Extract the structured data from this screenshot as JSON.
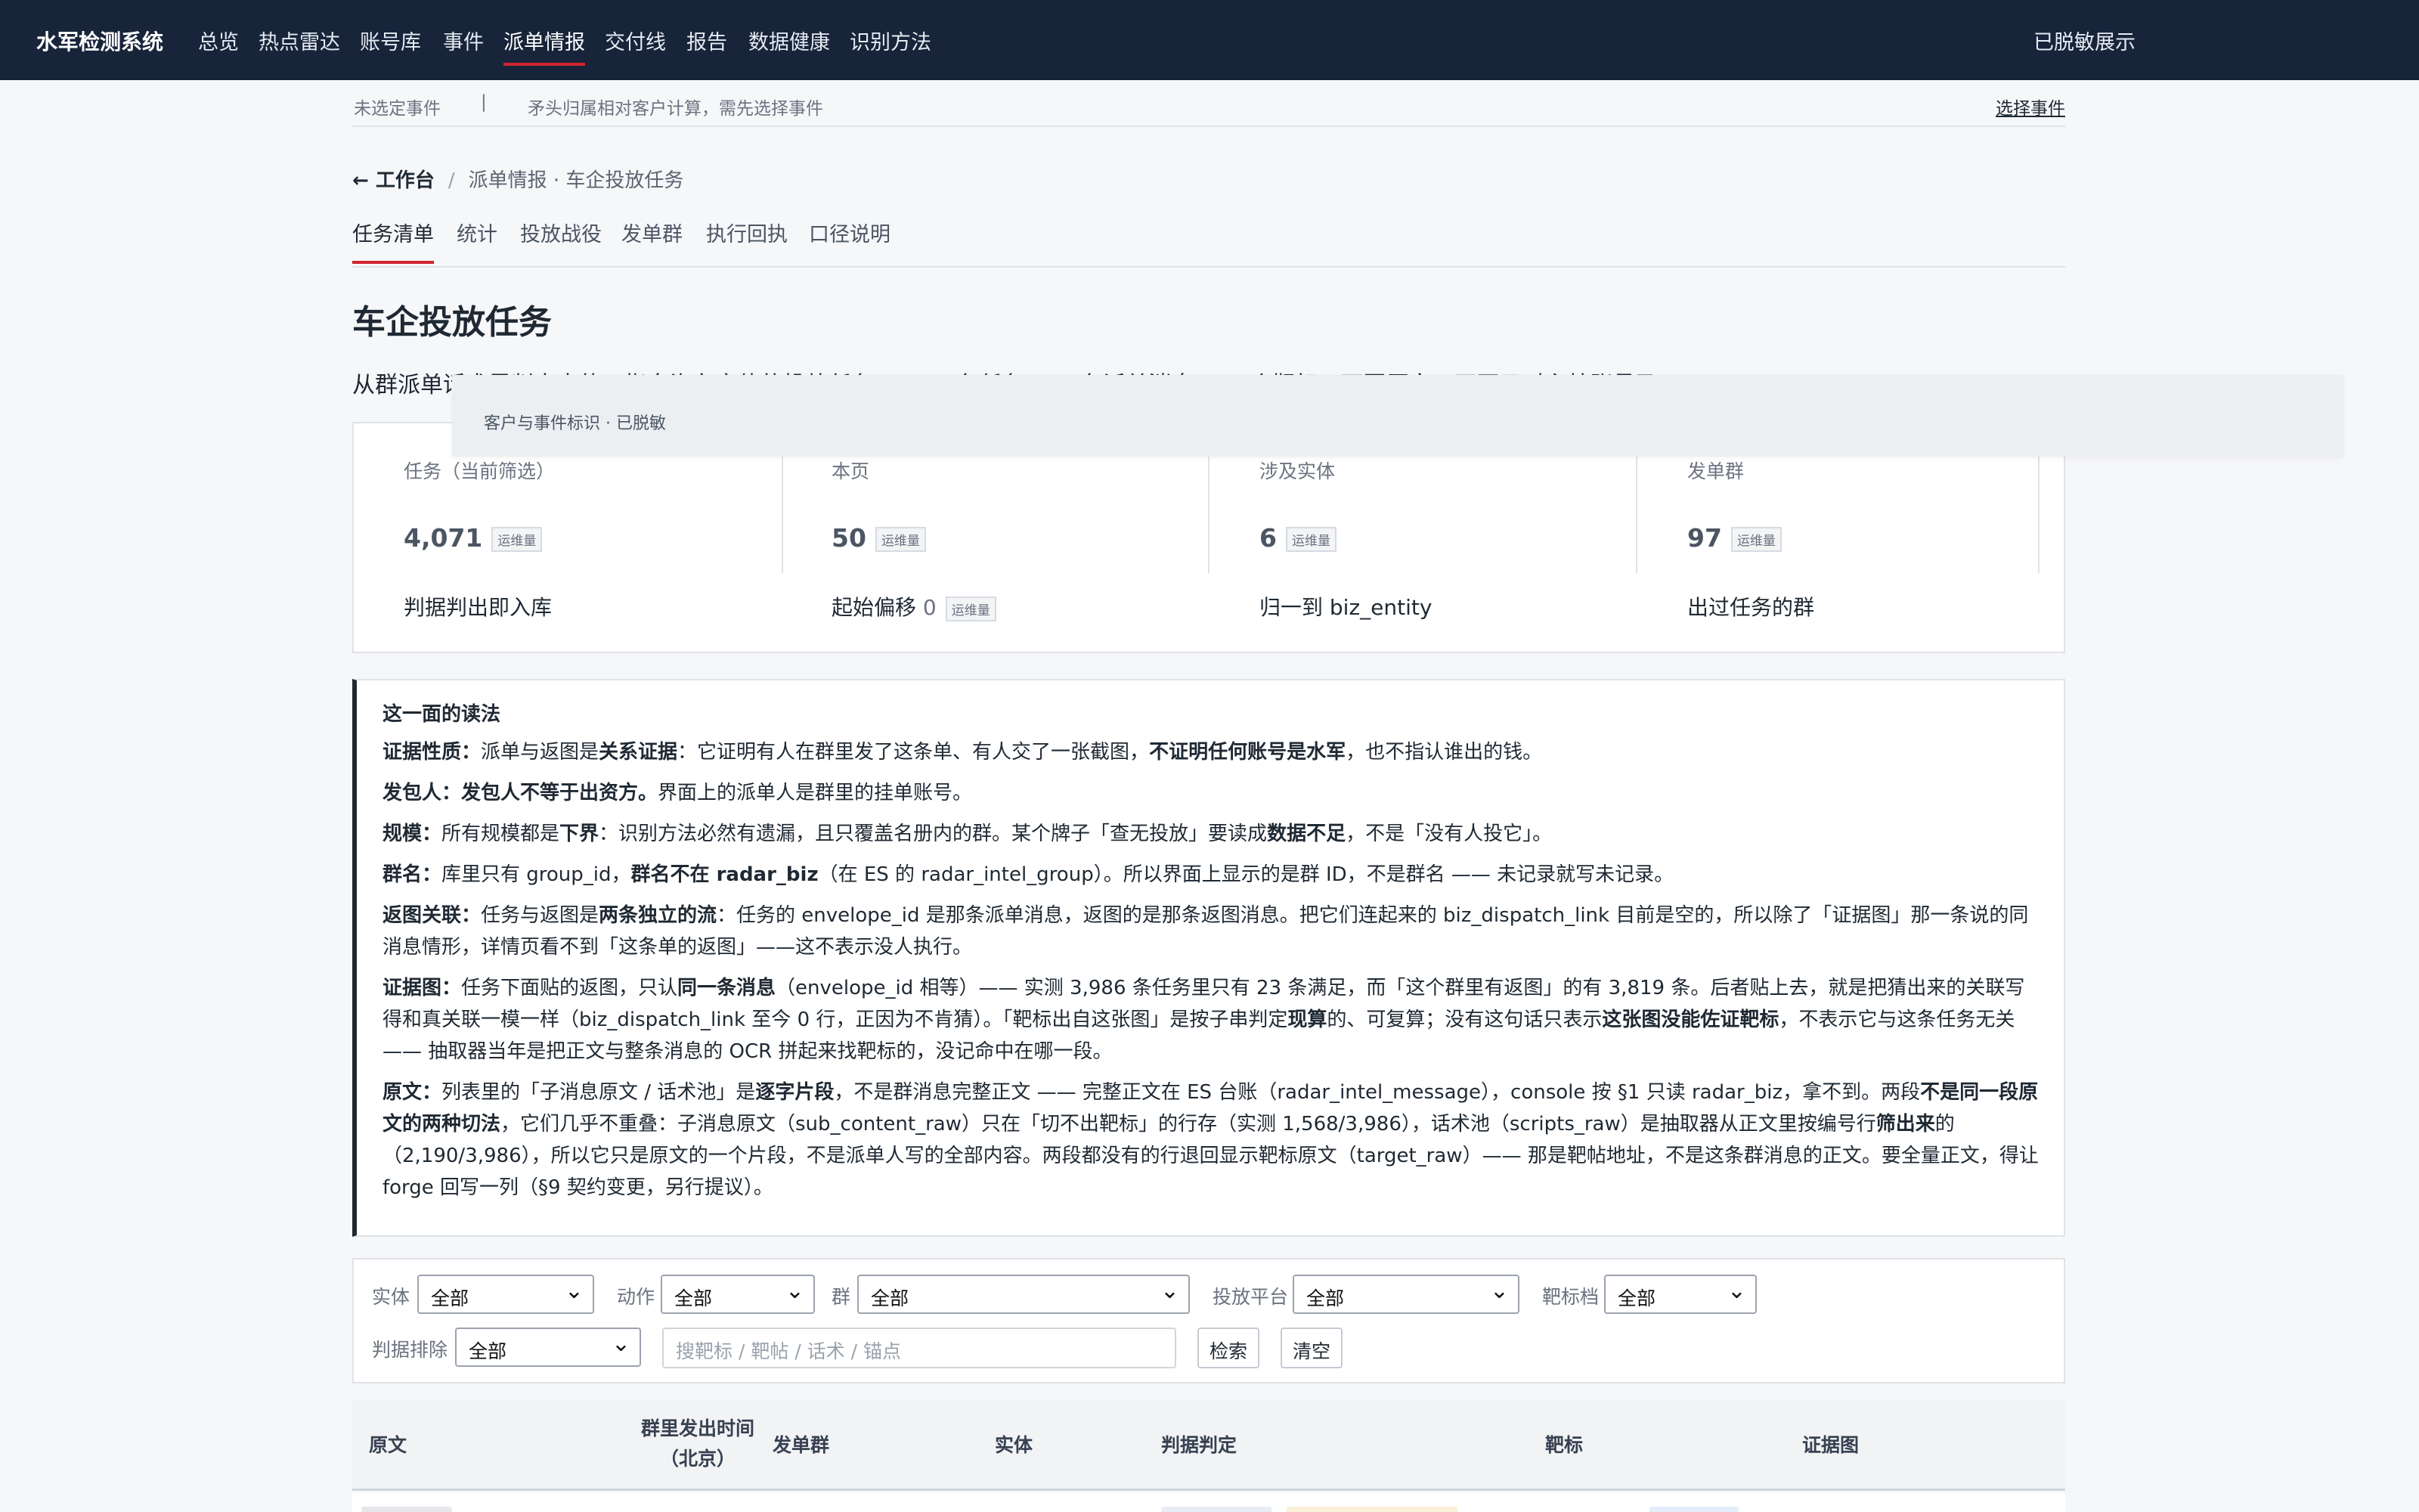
{
  "nav": {
    "brand": "水军检测系统",
    "items": [
      "总览",
      "热点雷达",
      "账号库",
      "事件",
      "派单情报",
      "交付线",
      "报告",
      "数据健康",
      "识别方法"
    ],
    "active": "派单情报",
    "right": "已脱敏展示"
  },
  "eventbar": {
    "status": "未选定事件",
    "separator": "|",
    "hint": "矛头归属相对客户计算，需先选择事件",
    "pick": "选择事件"
  },
  "breadcrumb": {
    "back": "← 工作台",
    "slash": "/",
    "current": "派单情报 · 车企投放任务"
  },
  "tabs": [
    "任务清单",
    "统计",
    "投放战役",
    "发单群",
    "执行回执",
    "口径说明"
  ],
  "active_tab": "任务清单",
  "page_title": "车企投放任务",
  "intro": "从群派单话术里判出来的、指向汽车实体的投放任务 —— 一条任务 = 一条派单消息 + 一个靶标，可回原文，不再只对主帖账号开放",
  "tooltip": "客户与事件标识 · 已脱敏",
  "stats": [
    {
      "label": "任务（当前筛选）",
      "value": "4,071",
      "tag": "运维量",
      "foot": "判据判出即入库"
    },
    {
      "label": "本页",
      "value": "50",
      "tag": "运维量",
      "foot": "起始偏移",
      "foot_value": "0",
      "foot_tag": "运维量"
    },
    {
      "label": "涉及实体",
      "value": "6",
      "tag": "运维量",
      "foot": "归一到 biz_entity"
    },
    {
      "label": "发单群",
      "value": "97",
      "tag": "运维量",
      "foot": "出过任务的群"
    }
  ],
  "guide": {
    "heading": "这一面的读法",
    "p1": {
      "k": "证据性质：",
      "a": "派单与返图是",
      "b1": "关系证据",
      "c": "：它证明有人在群里发了这条单、有人交了一张截图，",
      "b2": "不证明任何账号是水军",
      "d": "，也不指认谁出的钱。"
    },
    "p2": {
      "k": "发包人：",
      "b1": "发包人不等于出资方。",
      "a": "界面上的派单人是群里的挂单账号。"
    },
    "p3": {
      "k": "规模：",
      "a": "所有规模都是",
      "b1": "下界",
      "c": "：识别方法必然有遗漏，且只覆盖名册内的群。某个牌子「查无投放」要读成",
      "b2": "数据不足",
      "d": "，不是「没有人投它」。"
    },
    "p4": {
      "k": "群名：",
      "a": "库里只有 group_id，",
      "b1": "群名不在 radar_biz",
      "c": "（在 ES 的 radar_intel_group）。所以界面上显示的是群 ID，不是群名 —— 未记录就写未记录。"
    },
    "p5": {
      "k": "返图关联：",
      "a": "任务与返图是",
      "b1": "两条独立的流",
      "c": "：任务的 envelope_id 是那条派单消息，返图的是那条返图消息。把它们连起来的 biz_dispatch_link 目前是空的，所以除了「证据图」那一条说的同消息情形，详情页看不到「这条单的返图」——这不表示没人执行。"
    },
    "p6": {
      "k": "证据图：",
      "a": "任务下面贴的返图，只认",
      "b1": "同一条消息",
      "c": "（envelope_id 相等）—— 实测 3,986 条任务里只有 23 条满足，而「这个群里有返图」的有 3,819 条。后者贴上去，就是把猜出来的关联写得和真关联一模一样（biz_dispatch_link 至今 0 行，正因为不肯猜）。「靶标出自这张图」是按子串判定",
      "b2": "现算",
      "d": "的、可复算；没有这句话只表示",
      "b3": "这张图没能佐证靶标",
      "e": "，不表示它与这条任务无关 —— 抽取器当年是把正文与整条消息的 OCR 拼起来找靶标的，没记命中在哪一段。"
    },
    "p7": {
      "k": "原文：",
      "a": "列表里的「子消息原文 / 话术池」是",
      "b1": "逐字片段",
      "c": "，不是群消息完整正文 —— 完整正文在 ES 台账（radar_intel_message），console 按 §1 只读 radar_biz，拿不到。两段",
      "b2": "不是同一段原文的两种切法",
      "d": "，它们几乎不重叠：子消息原文（sub_content_raw）只在「切不出靶标」的行存（实测 1,568/3,986），话术池（scripts_raw）是抽取器从正文里按编号行",
      "b3": "筛出来",
      "e": "的（2,190/3,986），所以它只是原文的一个片段，不是派单人写的全部内容。两段都没有的行退回显示靶标原文（target_raw）—— 那是靶帖地址，不是这条群消息的正文。要全量正文，得让 forge 回写一列（§9 契约变更，另行提议）。"
    }
  },
  "filters": {
    "entity": {
      "label": "实体",
      "value": "全部"
    },
    "action": {
      "label": "动作",
      "value": "全部"
    },
    "group": {
      "label": "群",
      "value": "全部"
    },
    "platform": {
      "label": "投放平台",
      "value": "全部"
    },
    "target_tier": {
      "label": "靶标档",
      "value": "全部"
    },
    "exclude": {
      "label": "判据排除",
      "value": "全部"
    },
    "search_placeholder": "搜靶标 / 靶帖 / 话术 / 锚点",
    "search_button": "检索",
    "clear_button": "清空"
  },
  "table": {
    "headers": [
      "原文",
      "群里发出时间\n（北京）",
      "发单群",
      "实体",
      "判据判定",
      "靶标",
      "证据图"
    ]
  },
  "colors": {
    "nav_bg": "#17243a",
    "accent": "#d1242f",
    "page_bg": "#f6f7f9"
  }
}
